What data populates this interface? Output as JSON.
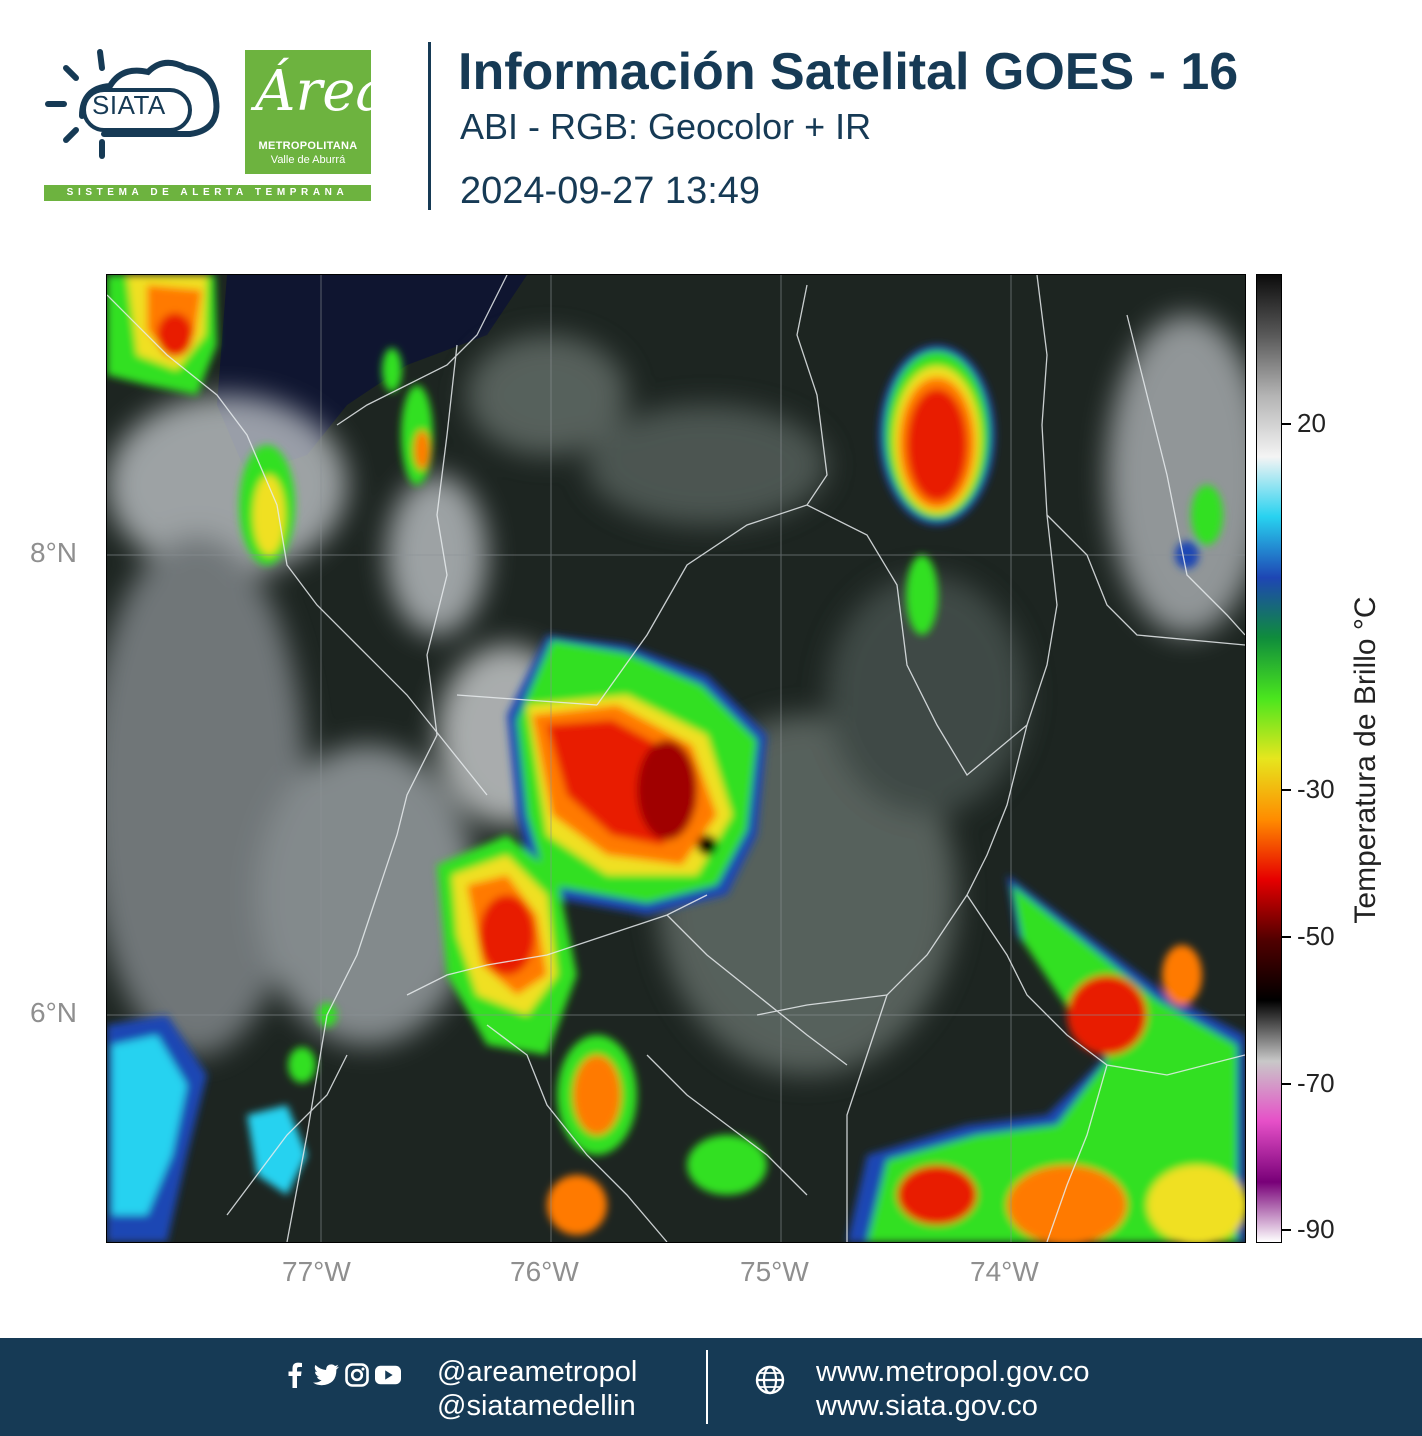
{
  "header": {
    "logo_siata": "SIATA",
    "logo_tagline": "SISTEMA DE ALERTA TEMPRANA",
    "logo_area_script": "Área",
    "logo_area_metro": "METROPOLITANA",
    "logo_area_valle": "Valle de Aburrá",
    "title": "Información Satelital GOES - 16",
    "subtitle": "ABI - RGB: Geocolor + IR",
    "timestamp": "2024-09-27 13:49"
  },
  "map": {
    "lat_labels": [
      "8°N",
      "6°N"
    ],
    "lon_labels": [
      "77°W",
      "76°W",
      "75°W",
      "74°W"
    ]
  },
  "colorbar": {
    "title": "Temperatura de Brillo °C",
    "tick_labels": [
      "20",
      "-30",
      "-50",
      "-70",
      "-90"
    ],
    "stops": [
      {
        "color": "#0c0c0c"
      },
      {
        "color": "#5a5a5a"
      },
      {
        "color": "#b4b4b4"
      },
      {
        "color": "#f4f4f4"
      },
      {
        "color": "#28d2f0"
      },
      {
        "color": "#1e46b4"
      },
      {
        "color": "#0f8c3c"
      },
      {
        "color": "#4be61e"
      },
      {
        "color": "#e6e61e"
      },
      {
        "color": "#ff8c00"
      },
      {
        "color": "#e60000"
      },
      {
        "color": "#500000"
      },
      {
        "color": "#000000"
      },
      {
        "color": "#c8c8c8"
      },
      {
        "color": "#e650c8"
      },
      {
        "color": "#780078"
      },
      {
        "color": "#ffffff"
      }
    ]
  },
  "footer": {
    "social_icons": [
      "facebook-icon",
      "twitter-icon",
      "instagram-icon",
      "youtube-icon"
    ],
    "handle_1": "@areametropol",
    "handle_2": "@siatamedellin",
    "url_1": "www.metropol.gov.co",
    "url_2": "www.siata.gov.co",
    "colors": {
      "footer_bg": "#163a55",
      "brand_green": "#6db33f"
    }
  }
}
